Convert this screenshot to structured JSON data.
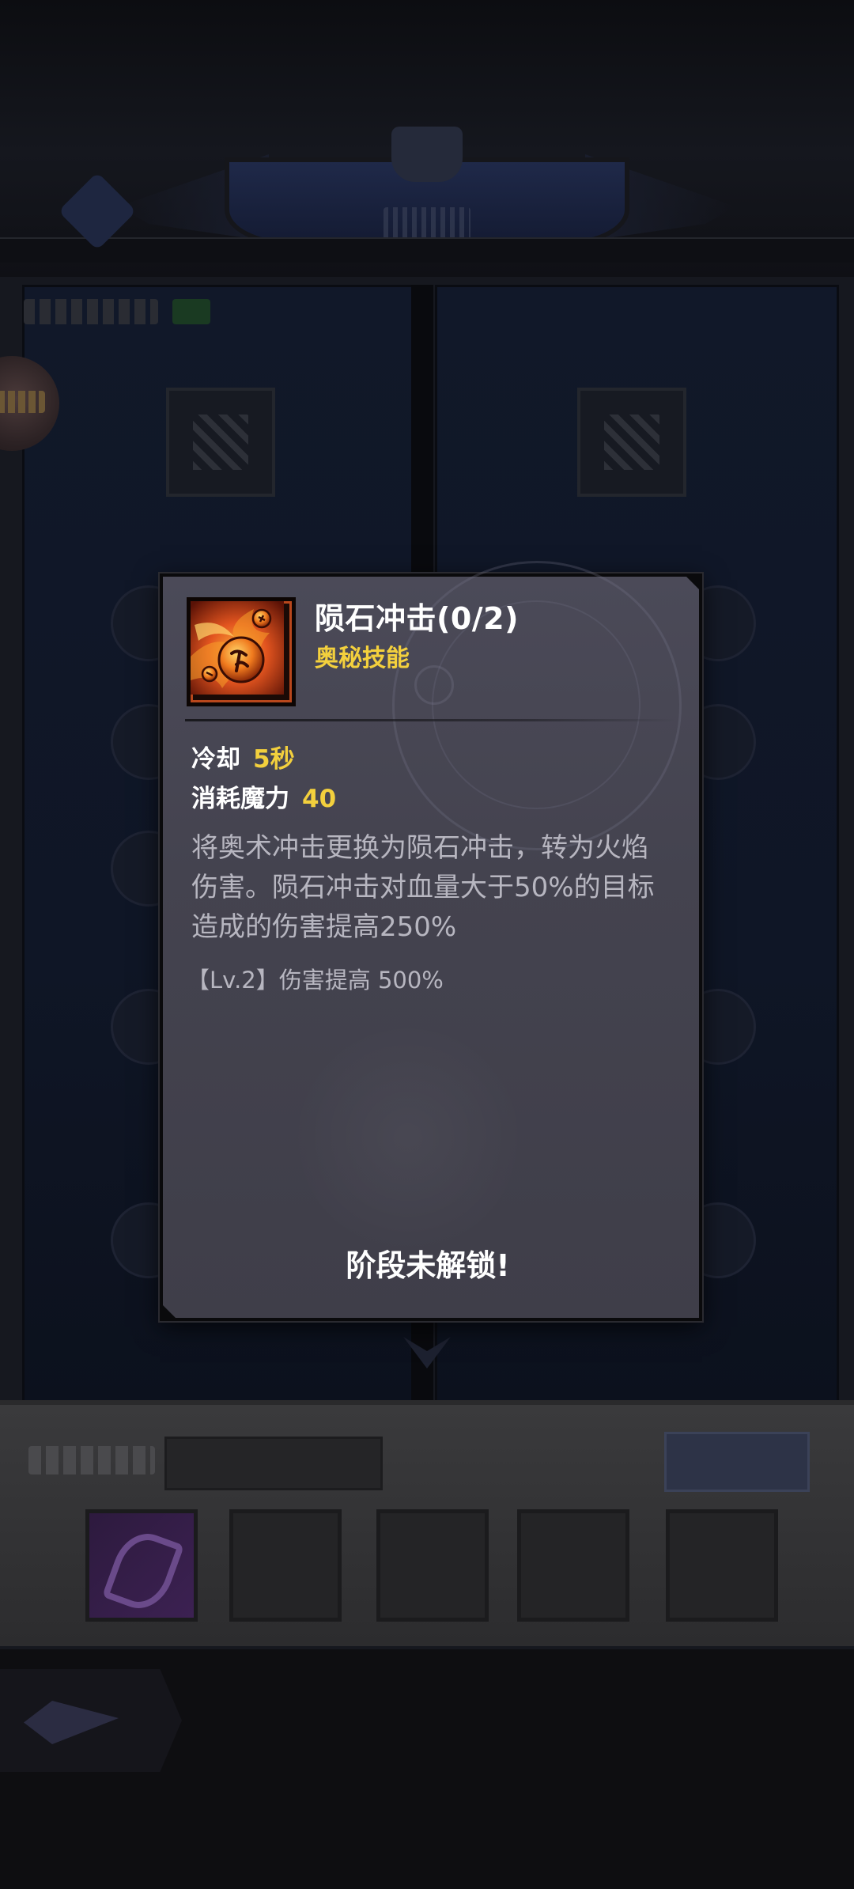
{
  "skill_popup": {
    "name": "陨石冲击(0/2)",
    "type": "奥秘技能",
    "cooldown_label": "冷却",
    "cooldown_value": "5秒",
    "mana_label": "消耗魔力",
    "mana_value": "40",
    "description": "将奥术冲击更换为陨石冲击，转为火焰伤害。陨石冲击对血量大于50%的目标造成的伤害提高250%",
    "level_bonus": "【Lv.2】伤害提高 500%",
    "lock_status": "阶段未解锁!"
  },
  "colors": {
    "title": "#ffffff",
    "skill_type": "#f3d03d",
    "stat_value": "#f3d03d",
    "description": "#b7b6c0",
    "popup_bg": "#45444f",
    "icon_fire": "#e2541f"
  },
  "icons": {
    "skill_icon": "meteor-fire-icon"
  }
}
